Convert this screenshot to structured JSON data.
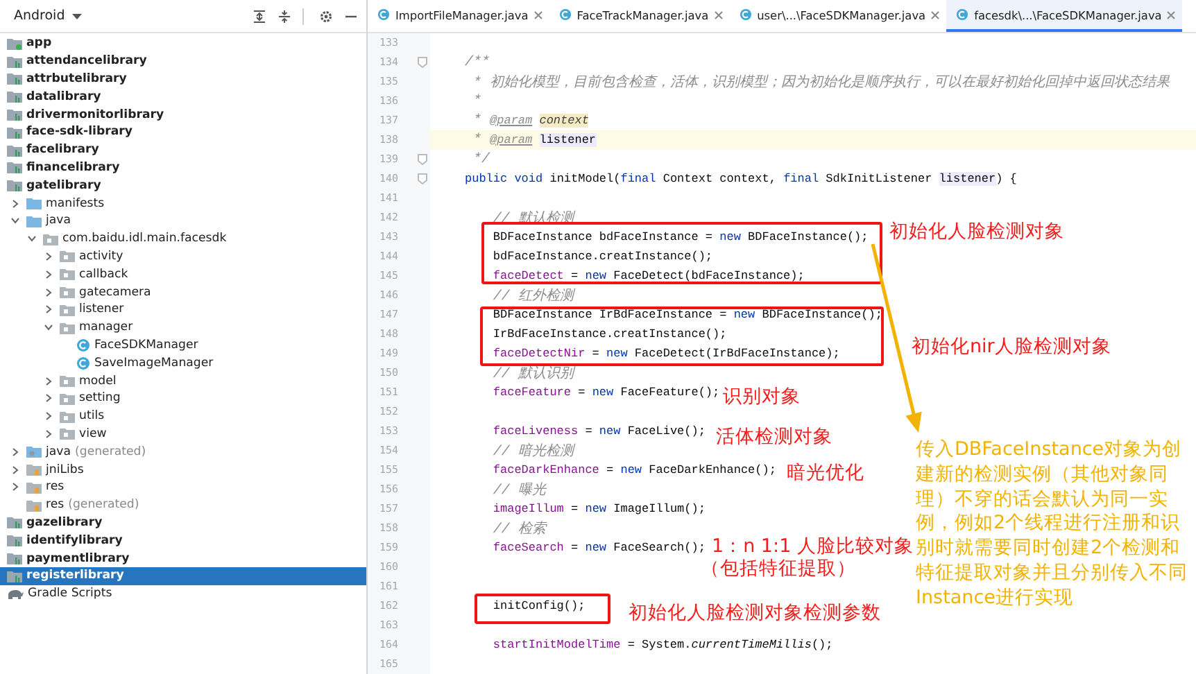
{
  "sidebar": {
    "view": "Android",
    "tree": [
      {
        "label": "app",
        "kind": "app",
        "selected": false
      },
      {
        "label": "attendancelibrary",
        "kind": "module",
        "selected": false
      },
      {
        "label": "attrbutelibrary",
        "kind": "module",
        "selected": false
      },
      {
        "label": "datalibrary",
        "kind": "module",
        "selected": false
      },
      {
        "label": "drivermonitorlibrary",
        "kind": "module",
        "selected": false
      },
      {
        "label": "face-sdk-library",
        "kind": "module",
        "selected": false
      },
      {
        "label": "facelibrary",
        "kind": "module",
        "selected": false
      },
      {
        "label": "financelibrary",
        "kind": "module",
        "selected": false
      },
      {
        "label": "gatelibrary",
        "kind": "module",
        "selected": false,
        "children": [
          {
            "label": "manifests",
            "kind": "folder",
            "expanded": false,
            "selected": false
          },
          {
            "label": "java",
            "kind": "folder",
            "expanded": true,
            "selected": false,
            "children": [
              {
                "label": "com.baidu.idl.main.facesdk",
                "kind": "package",
                "expanded": true,
                "selected": false,
                "children": [
                  {
                    "label": "activity",
                    "kind": "package",
                    "expanded": false,
                    "selected": false
                  },
                  {
                    "label": "callback",
                    "kind": "package",
                    "expanded": false,
                    "selected": false
                  },
                  {
                    "label": "gatecamera",
                    "kind": "package",
                    "expanded": false,
                    "selected": false
                  },
                  {
                    "label": "listener",
                    "kind": "package",
                    "expanded": false,
                    "selected": false
                  },
                  {
                    "label": "manager",
                    "kind": "package",
                    "expanded": true,
                    "selected": false,
                    "children": [
                      {
                        "label": "FaceSDKManager",
                        "kind": "class",
                        "selected": false
                      },
                      {
                        "label": "SaveImageManager",
                        "kind": "class",
                        "selected": false
                      }
                    ]
                  },
                  {
                    "label": "model",
                    "kind": "package",
                    "expanded": false,
                    "selected": false
                  },
                  {
                    "label": "setting",
                    "kind": "package",
                    "expanded": false,
                    "selected": false
                  },
                  {
                    "label": "utils",
                    "kind": "package",
                    "expanded": false,
                    "selected": false
                  },
                  {
                    "label": "view",
                    "kind": "package",
                    "expanded": false,
                    "selected": false
                  }
                ]
              }
            ]
          },
          {
            "label": "java",
            "note": "(generated)",
            "kind": "generated",
            "expanded": false,
            "selected": false
          },
          {
            "label": "jniLibs",
            "kind": "resource",
            "expanded": false,
            "selected": false
          },
          {
            "label": "res",
            "kind": "resource",
            "expanded": false,
            "selected": false
          },
          {
            "label": "res",
            "note": "(generated)",
            "kind": "resource",
            "selected": false
          }
        ]
      },
      {
        "label": "gazelibrary",
        "kind": "module",
        "selected": false
      },
      {
        "label": "identifylibrary",
        "kind": "module",
        "selected": false
      },
      {
        "label": "paymentlibrary",
        "kind": "module",
        "selected": false
      },
      {
        "label": "registerlibrary",
        "kind": "module",
        "selected": true
      },
      {
        "label": "Gradle Scripts",
        "kind": "gradle",
        "selected": false
      }
    ]
  },
  "tabs": [
    {
      "label": "ImportFileManager.java",
      "selected": false
    },
    {
      "label": "FaceTrackManager.java",
      "selected": false
    },
    {
      "label": "user\\...\\FaceSDKManager.java",
      "selected": false
    },
    {
      "label": "facesdk\\...\\FaceSDKManager.java",
      "selected": true
    }
  ],
  "editor": {
    "lines": [
      {
        "number": "133"
      },
      {
        "number": "134",
        "fold": true,
        "segments": [
          {
            "kind": "comment",
            "text": "/**"
          }
        ]
      },
      {
        "number": "135",
        "segments": [
          {
            "kind": "comment",
            "text": " * 初始化模型，目前包含检查，活体，识别模型；因为初始化是顺序执行，可以在最好初始化回掉中返回状态结果"
          }
        ]
      },
      {
        "number": "136",
        "segments": [
          {
            "kind": "comment",
            "text": " *"
          }
        ]
      },
      {
        "number": "137",
        "segments": [
          {
            "kind": "comment",
            "text": " * "
          },
          {
            "kind": "doctag",
            "text": "@param"
          },
          {
            "kind": "param",
            "text": "context"
          }
        ]
      },
      {
        "number": "138",
        "current": true,
        "segments": [
          {
            "kind": "comment",
            "text": " * "
          },
          {
            "kind": "doctag",
            "text": "@param"
          },
          {
            "kind": "ref",
            "text": "listener"
          }
        ]
      },
      {
        "number": "139",
        "fold": true,
        "segments": [
          {
            "kind": "comment",
            "text": " */"
          }
        ]
      },
      {
        "number": "140",
        "fold": true,
        "segments": [
          {
            "kind": "keyword",
            "text": "public void "
          },
          {
            "kind": "plain",
            "text": "initModel("
          },
          {
            "kind": "keyword",
            "text": "final "
          },
          {
            "kind": "plain",
            "text": "Context context, "
          },
          {
            "kind": "keyword",
            "text": "final "
          },
          {
            "kind": "plain",
            "text": "SdkInitListener "
          },
          {
            "kind": "ref",
            "text": "listener"
          },
          {
            "kind": "plain",
            "text": ") {"
          }
        ],
        "children": [
          {
            "number": "141"
          },
          {
            "number": "142",
            "segments": [
              {
                "kind": "comment",
                "text": "// 默认检测"
              }
            ]
          },
          {
            "number": "143",
            "segments": [
              {
                "kind": "plain",
                "text": "BDFaceInstance bdFaceInstance = "
              },
              {
                "kind": "keyword",
                "text": "new"
              },
              {
                "kind": "plain",
                "text": " BDFaceInstance();"
              }
            ]
          },
          {
            "number": "144",
            "segments": [
              {
                "kind": "plain",
                "text": "bdFaceInstance.creatInstance();"
              }
            ]
          },
          {
            "number": "145",
            "segments": [
              {
                "kind": "field",
                "text": "faceDetect"
              },
              {
                "kind": "plain",
                "text": " = "
              },
              {
                "kind": "keyword",
                "text": "new"
              },
              {
                "kind": "plain",
                "text": " FaceDetect(bdFaceInstance);"
              }
            ]
          },
          {
            "number": "146",
            "segments": [
              {
                "kind": "comment",
                "text": "// 红外检测"
              }
            ]
          },
          {
            "number": "147",
            "segments": [
              {
                "kind": "plain",
                "text": "BDFaceInstance IrBdFaceInstance = "
              },
              {
                "kind": "keyword",
                "text": "new"
              },
              {
                "kind": "plain",
                "text": " BDFaceInstance();"
              }
            ]
          },
          {
            "number": "148",
            "segments": [
              {
                "kind": "plain",
                "text": "IrBdFaceInstance.creatInstance();"
              }
            ]
          },
          {
            "number": "149",
            "segments": [
              {
                "kind": "field",
                "text": "faceDetectNir"
              },
              {
                "kind": "plain",
                "text": " = "
              },
              {
                "kind": "keyword",
                "text": "new"
              },
              {
                "kind": "plain",
                "text": " FaceDetect(IrBdFaceInstance);"
              }
            ]
          },
          {
            "number": "150",
            "segments": [
              {
                "kind": "comment",
                "text": "// 默认识别"
              }
            ]
          },
          {
            "number": "151",
            "segments": [
              {
                "kind": "field",
                "text": "faceFeature"
              },
              {
                "kind": "plain",
                "text": " = "
              },
              {
                "kind": "keyword",
                "text": "new"
              },
              {
                "kind": "plain",
                "text": " FaceFeature();"
              }
            ]
          },
          {
            "number": "152"
          },
          {
            "number": "153",
            "segments": [
              {
                "kind": "field",
                "text": "faceLiveness"
              },
              {
                "kind": "plain",
                "text": " = "
              },
              {
                "kind": "keyword",
                "text": "new"
              },
              {
                "kind": "plain",
                "text": " FaceLive();"
              }
            ]
          },
          {
            "number": "154",
            "segments": [
              {
                "kind": "comment",
                "text": "// 暗光检测"
              }
            ]
          },
          {
            "number": "155",
            "segments": [
              {
                "kind": "field",
                "text": "faceDarkEnhance"
              },
              {
                "kind": "plain",
                "text": " = "
              },
              {
                "kind": "keyword",
                "text": "new"
              },
              {
                "kind": "plain",
                "text": " FaceDarkEnhance();"
              }
            ]
          },
          {
            "number": "156",
            "segments": [
              {
                "kind": "comment",
                "text": "// 曝光"
              }
            ]
          },
          {
            "number": "157",
            "segments": [
              {
                "kind": "field",
                "text": "imageIllum"
              },
              {
                "kind": "plain",
                "text": " = "
              },
              {
                "kind": "keyword",
                "text": "new"
              },
              {
                "kind": "plain",
                "text": " ImageIllum();"
              }
            ]
          },
          {
            "number": "158",
            "segments": [
              {
                "kind": "comment",
                "text": "// 检索"
              }
            ]
          },
          {
            "number": "159",
            "segments": [
              {
                "kind": "field",
                "text": "faceSearch"
              },
              {
                "kind": "plain",
                "text": " = "
              },
              {
                "kind": "keyword",
                "text": "new"
              },
              {
                "kind": "plain",
                "text": " FaceSearch();"
              }
            ]
          },
          {
            "number": "160"
          },
          {
            "number": "161"
          },
          {
            "number": "162",
            "segments": [
              {
                "kind": "plain",
                "text": "initConfig();"
              }
            ]
          },
          {
            "number": "163"
          },
          {
            "number": "164",
            "segments": [
              {
                "kind": "field",
                "text": "startInitModelTime"
              },
              {
                "kind": "plain",
                "text": " = System."
              },
              {
                "kind": "static",
                "text": "currentTimeMillis"
              },
              {
                "kind": "plain",
                "text": "();"
              }
            ]
          },
          {
            "number": "165"
          }
        ]
      }
    ]
  },
  "annotations": [
    {
      "text": "初始化人脸检测对象"
    },
    {
      "text": "初始化nir人脸检测对象"
    },
    {
      "text": "识别对象"
    },
    {
      "text": "活体检测对象"
    },
    {
      "text": "暗光优化"
    },
    {
      "text": "1：n 1:1 人脸比较对象"
    },
    {
      "text": "（包括特征提取）"
    },
    {
      "text": "初始化人脸检测对象检测参数"
    }
  ],
  "callout": {
    "text": "传入DBFaceInstance对象为创建新的检测实例（其他对象同理）不穿的话会默认为同一实例，例如2个线程进行注册和识别时就需要同时创建2个检测和特征提取对象并且分别传入不同Instance进行实现"
  }
}
